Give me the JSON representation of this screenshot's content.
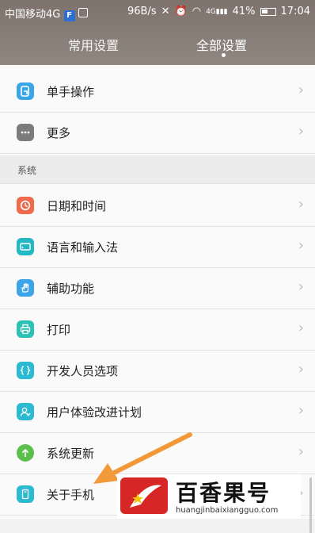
{
  "status_bar": {
    "carrier": "中国移动4G",
    "speed": "96B/s",
    "network": "4G",
    "battery": "41%",
    "time": "17:04"
  },
  "tabs": {
    "common": "常用设置",
    "all": "全部设置"
  },
  "items_top": [
    {
      "label": "单手操作",
      "icon": "one-hand-icon",
      "color": "#3aa6e6"
    },
    {
      "label": "更多",
      "icon": "more-dots-icon",
      "color": "#7c7c7c"
    }
  ],
  "section_system": "系统",
  "items_system": [
    {
      "label": "日期和时间",
      "icon": "clock-icon",
      "color": "#f06a4c"
    },
    {
      "label": "语言和输入法",
      "icon": "keyboard-icon",
      "color": "#24b7c4"
    },
    {
      "label": "辅助功能",
      "icon": "hand-icon",
      "color": "#3ea4e8"
    },
    {
      "label": "打印",
      "icon": "printer-icon",
      "color": "#2cc1b3"
    },
    {
      "label": "开发人员选项",
      "icon": "code-braces-icon",
      "color": "#2cbad0"
    },
    {
      "label": "用户体验改进计划",
      "icon": "user-experience-icon",
      "color": "#2cbad0"
    },
    {
      "label": "系统更新",
      "icon": "update-arrow-icon",
      "color": "#5cbf4d"
    },
    {
      "label": "关于手机",
      "icon": "phone-icon",
      "color": "#2cbad0"
    }
  ],
  "watermark": {
    "title": "百香果号",
    "url": "huangjinbaixiangguo.com"
  },
  "colors": {
    "header": "#8a8079",
    "arrow": "#f2993a",
    "watermark_red": "#d62626"
  }
}
